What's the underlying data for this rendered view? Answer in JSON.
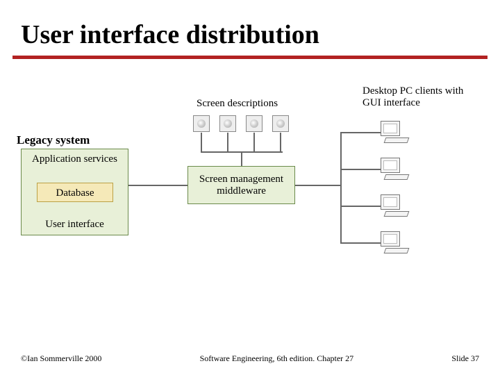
{
  "title": "User interface distribution",
  "legacy": {
    "label": "Legacy system",
    "application": "Application services",
    "database": "Database",
    "user_interface": "User interface"
  },
  "screen_descriptions_label": "Screen descriptions",
  "middleware_label": "Screen management middleware",
  "clients_label": "Desktop PC clients with GUI interface",
  "footer": {
    "left": "©Ian Sommerville 2000",
    "center": "Software Engineering, 6th edition. Chapter 27",
    "right": "Slide 37"
  }
}
